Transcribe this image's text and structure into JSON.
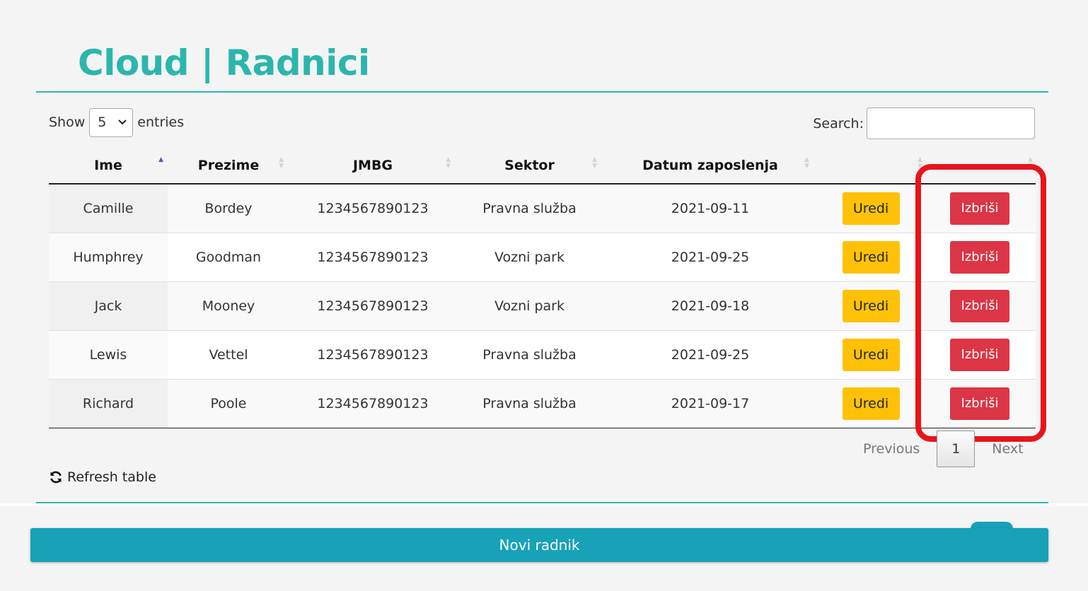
{
  "title": "Cloud | Radnici",
  "length_menu": {
    "prefix": "Show",
    "value": "5",
    "suffix": "entries"
  },
  "search": {
    "label": "Search:",
    "value": ""
  },
  "columns": [
    "Ime",
    "Prezime",
    "JMBG",
    "Sektor",
    "Datum zaposlenja",
    "",
    ""
  ],
  "rows": [
    {
      "ime": "Camille",
      "prezime": "Bordey",
      "jmbg": "1234567890123",
      "sektor": "Pravna služba",
      "datum": "2021-09-11"
    },
    {
      "ime": "Humphrey",
      "prezime": "Goodman",
      "jmbg": "1234567890123",
      "sektor": "Vozni park",
      "datum": "2021-09-25"
    },
    {
      "ime": "Jack",
      "prezime": "Mooney",
      "jmbg": "1234567890123",
      "sektor": "Vozni park",
      "datum": "2021-09-18"
    },
    {
      "ime": "Lewis",
      "prezime": "Vettel",
      "jmbg": "1234567890123",
      "sektor": "Pravna služba",
      "datum": "2021-09-25"
    },
    {
      "ime": "Richard",
      "prezime": "Poole",
      "jmbg": "1234567890123",
      "sektor": "Pravna služba",
      "datum": "2021-09-17"
    }
  ],
  "actions": {
    "edit_label": "Uredi",
    "delete_label": "Izbriši"
  },
  "pagination": {
    "previous": "Previous",
    "current": "1",
    "next": "Next"
  },
  "refresh_label": "Refresh table",
  "new_button_label": "Novi radnik",
  "colors": {
    "accent": "#2bb6ad",
    "edit": "#ffc107",
    "delete": "#dc3545",
    "primary": "#17a2b8",
    "highlight": "#e8141b"
  },
  "icons": {
    "refresh": "refresh-icon",
    "sort_asc": "sort-asc-icon",
    "sort_both": "sort-icon",
    "select_chevron": "chevron-down-icon"
  }
}
